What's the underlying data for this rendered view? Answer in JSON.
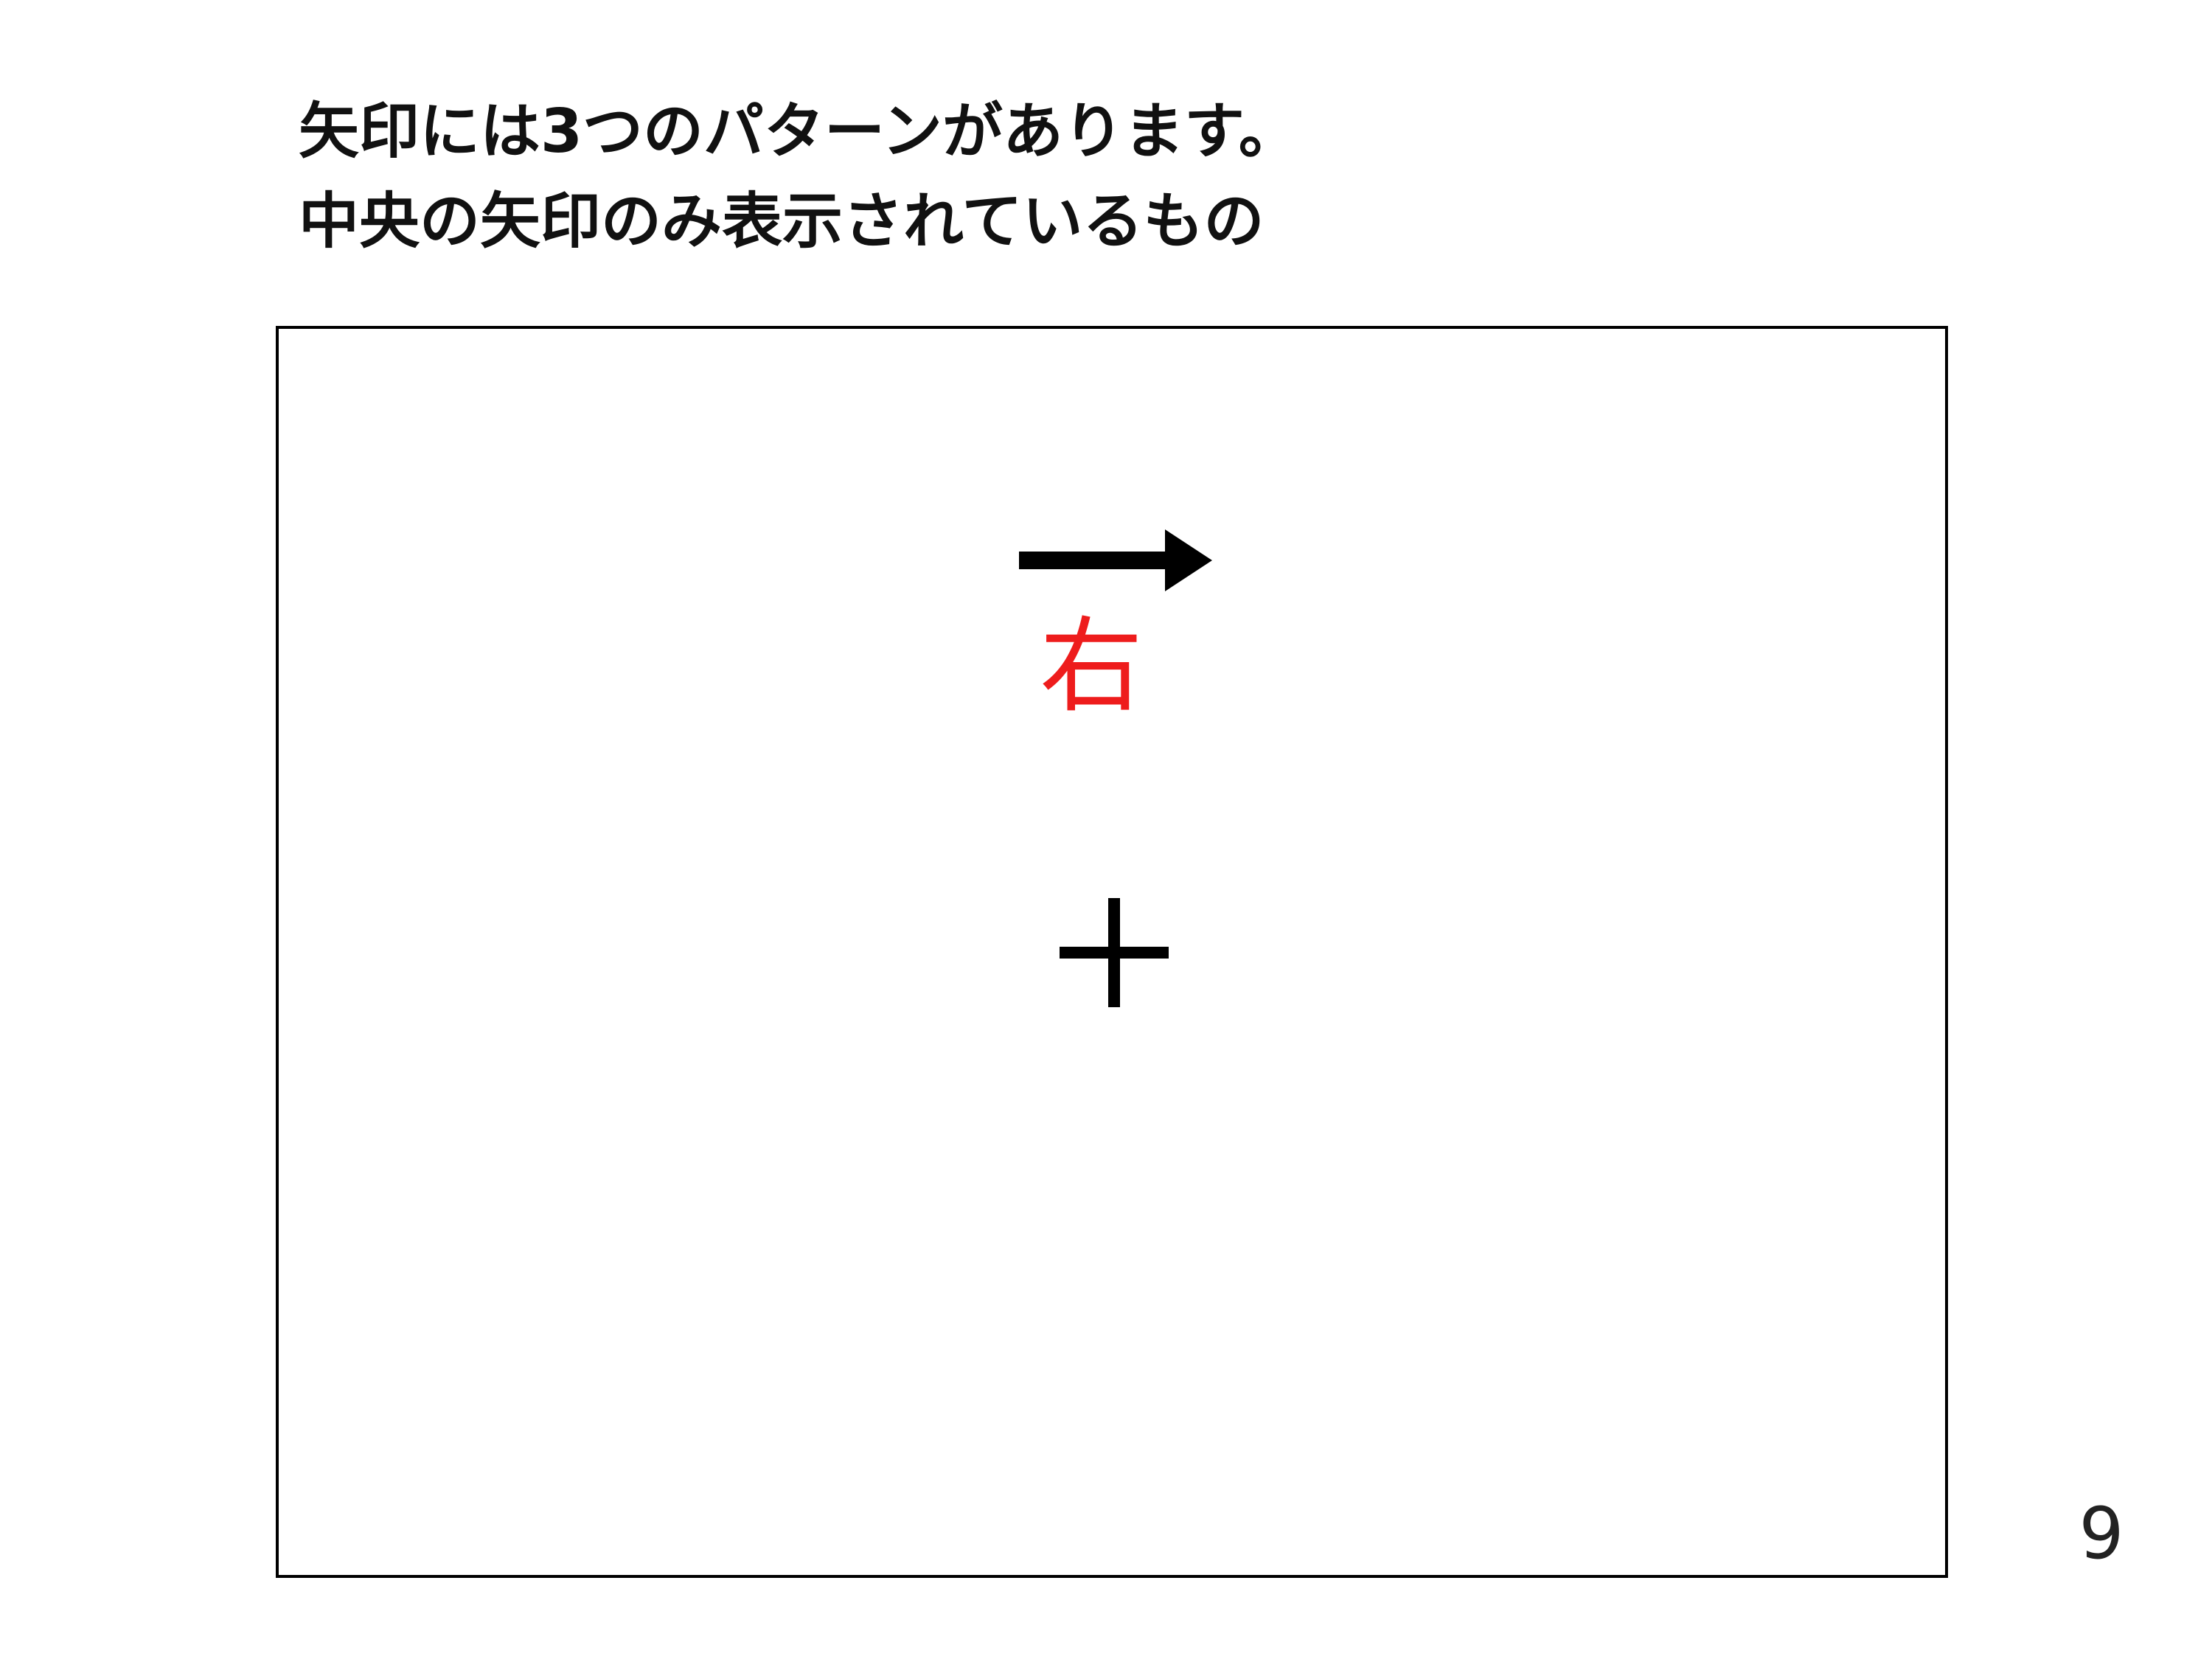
{
  "title": {
    "line1": "矢印には3つのパターンがあります。",
    "line2": "中央の矢印のみ表示されているもの"
  },
  "stimulus": {
    "arrow_direction": "right",
    "arrow_icon": "right-arrow-icon",
    "direction_label": "右",
    "label_color": "#ee1c1c",
    "fixation_icon": "plus-fixation-icon"
  },
  "page_number": "9"
}
